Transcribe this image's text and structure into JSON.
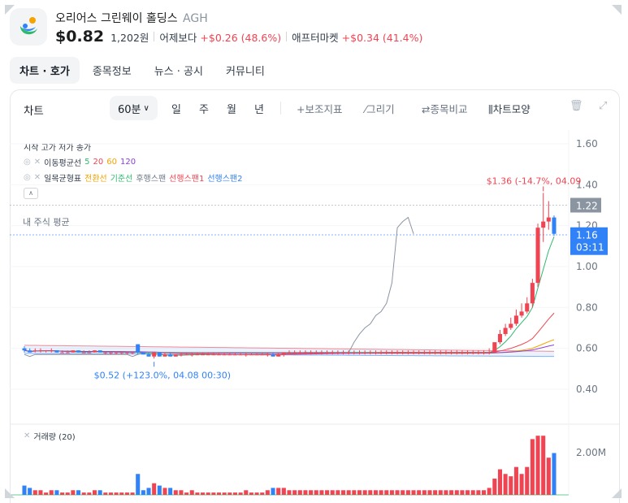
{
  "stock": {
    "name": "오리어스 그린웨이 홀딩스",
    "ticker": "AGH",
    "price": "$0.82",
    "price_krw": "1,202원",
    "prev_label": "어제보다",
    "prev_change": "+$0.26 (48.6%)",
    "after_label": "애프터마켓",
    "after_change": "+$0.34 (41.4%)"
  },
  "tabs": [
    "차트 · 호가",
    "종목정보",
    "뉴스 · 공시",
    "커뮤니티"
  ],
  "toolbar": {
    "title": "차트",
    "period": "60분",
    "periods": [
      "일",
      "주",
      "월",
      "년"
    ],
    "tools": [
      "+보조지표",
      "⁄그리기",
      "⇄종목비교",
      "⫼차트모양"
    ]
  },
  "legend": {
    "ohlc": "시작 고가 저가 종가",
    "ma_label": "이동평균선",
    "ma": [
      {
        "label": "5",
        "color": "#2dba6e"
      },
      {
        "label": "20",
        "color": "#f04452"
      },
      {
        "label": "60",
        "color": "#f4a300"
      },
      {
        "label": "120",
        "color": "#8b3fd9"
      }
    ],
    "ichimoku_label": "일목균형표",
    "ichimoku": [
      {
        "label": "전환선",
        "color": "#f4a300"
      },
      {
        "label": "기준선",
        "color": "#2dba6e"
      },
      {
        "label": "후행스팬",
        "color": "#6b7684"
      },
      {
        "label": "선행스팬1",
        "color": "#f04452"
      },
      {
        "label": "선행스팬2",
        "color": "#3182f6"
      }
    ],
    "volume_label": "거래량 (20)"
  },
  "annotations": {
    "avg_label": "내 주식 평균",
    "high": "$1.36 (-14.7%, 04.09",
    "low": "$0.52 (+123.0%, 04.08 00:30)",
    "last_price": "1.22",
    "current_price": "1.16",
    "countdown": "03:11"
  },
  "chart_data": {
    "type": "candlestick",
    "y_ticks": [
      "1.60",
      "1.40",
      "1.20",
      "1.00",
      "0.80",
      "0.60",
      "0.40"
    ],
    "ylim": [
      0.4,
      1.6
    ],
    "volume_tick": "2.00M",
    "candles": [
      {
        "o": 0.6,
        "h": 0.61,
        "l": 0.58,
        "c": 0.59
      },
      {
        "o": 0.59,
        "h": 0.6,
        "l": 0.58,
        "c": 0.58
      },
      {
        "o": 0.59,
        "h": 0.6,
        "l": 0.58,
        "c": 0.59
      },
      {
        "o": 0.59,
        "h": 0.6,
        "l": 0.58,
        "c": 0.59
      },
      {
        "o": 0.59,
        "h": 0.59,
        "l": 0.58,
        "c": 0.59
      },
      {
        "o": 0.59,
        "h": 0.6,
        "l": 0.58,
        "c": 0.59
      },
      {
        "o": 0.59,
        "h": 0.59,
        "l": 0.58,
        "c": 0.58
      },
      {
        "o": 0.58,
        "h": 0.59,
        "l": 0.58,
        "c": 0.58
      },
      {
        "o": 0.58,
        "h": 0.59,
        "l": 0.58,
        "c": 0.58
      },
      {
        "o": 0.58,
        "h": 0.59,
        "l": 0.58,
        "c": 0.59
      },
      {
        "o": 0.59,
        "h": 0.59,
        "l": 0.58,
        "c": 0.58
      },
      {
        "o": 0.58,
        "h": 0.59,
        "l": 0.58,
        "c": 0.58
      },
      {
        "o": 0.58,
        "h": 0.59,
        "l": 0.58,
        "c": 0.58
      },
      {
        "o": 0.58,
        "h": 0.59,
        "l": 0.58,
        "c": 0.59
      },
      {
        "o": 0.59,
        "h": 0.59,
        "l": 0.58,
        "c": 0.58
      },
      {
        "o": 0.58,
        "h": 0.58,
        "l": 0.57,
        "c": 0.58
      },
      {
        "o": 0.58,
        "h": 0.58,
        "l": 0.57,
        "c": 0.58
      },
      {
        "o": 0.58,
        "h": 0.58,
        "l": 0.57,
        "c": 0.58
      },
      {
        "o": 0.58,
        "h": 0.58,
        "l": 0.57,
        "c": 0.58
      },
      {
        "o": 0.58,
        "h": 0.58,
        "l": 0.57,
        "c": 0.58
      },
      {
        "o": 0.58,
        "h": 0.58,
        "l": 0.57,
        "c": 0.58
      },
      {
        "o": 0.62,
        "h": 0.62,
        "l": 0.57,
        "c": 0.58
      },
      {
        "o": 0.58,
        "h": 0.58,
        "l": 0.57,
        "c": 0.57
      },
      {
        "o": 0.57,
        "h": 0.58,
        "l": 0.56,
        "c": 0.56
      },
      {
        "o": 0.56,
        "h": 0.58,
        "l": 0.55,
        "c": 0.58
      },
      {
        "o": 0.58,
        "h": 0.58,
        "l": 0.56,
        "c": 0.56
      },
      {
        "o": 0.56,
        "h": 0.58,
        "l": 0.56,
        "c": 0.57
      },
      {
        "o": 0.57,
        "h": 0.58,
        "l": 0.56,
        "c": 0.56
      },
      {
        "o": 0.56,
        "h": 0.57,
        "l": 0.56,
        "c": 0.57
      },
      {
        "o": 0.57,
        "h": 0.58,
        "l": 0.56,
        "c": 0.57
      },
      {
        "o": 0.57,
        "h": 0.58,
        "l": 0.57,
        "c": 0.57
      },
      {
        "o": 0.57,
        "h": 0.58,
        "l": 0.56,
        "c": 0.57
      },
      {
        "o": 0.57,
        "h": 0.58,
        "l": 0.57,
        "c": 0.57
      },
      {
        "o": 0.57,
        "h": 0.58,
        "l": 0.57,
        "c": 0.57
      },
      {
        "o": 0.57,
        "h": 0.58,
        "l": 0.57,
        "c": 0.57
      },
      {
        "o": 0.57,
        "h": 0.58,
        "l": 0.57,
        "c": 0.57
      },
      {
        "o": 0.57,
        "h": 0.58,
        "l": 0.57,
        "c": 0.57
      },
      {
        "o": 0.57,
        "h": 0.58,
        "l": 0.57,
        "c": 0.57
      },
      {
        "o": 0.57,
        "h": 0.58,
        "l": 0.57,
        "c": 0.57
      },
      {
        "o": 0.57,
        "h": 0.58,
        "l": 0.57,
        "c": 0.57
      },
      {
        "o": 0.57,
        "h": 0.58,
        "l": 0.57,
        "c": 0.57
      },
      {
        "o": 0.57,
        "h": 0.58,
        "l": 0.56,
        "c": 0.57
      },
      {
        "o": 0.57,
        "h": 0.58,
        "l": 0.57,
        "c": 0.57
      },
      {
        "o": 0.57,
        "h": 0.58,
        "l": 0.57,
        "c": 0.57
      },
      {
        "o": 0.57,
        "h": 0.58,
        "l": 0.57,
        "c": 0.57
      },
      {
        "o": 0.57,
        "h": 0.58,
        "l": 0.56,
        "c": 0.57
      },
      {
        "o": 0.57,
        "h": 0.58,
        "l": 0.56,
        "c": 0.56
      },
      {
        "o": 0.56,
        "h": 0.58,
        "l": 0.56,
        "c": 0.57
      },
      {
        "o": 0.57,
        "h": 0.58,
        "l": 0.56,
        "c": 0.58
      },
      {
        "o": 0.58,
        "h": 0.59,
        "l": 0.57,
        "c": 0.58
      },
      {
        "o": 0.58,
        "h": 0.59,
        "l": 0.57,
        "c": 0.58
      },
      {
        "o": 0.58,
        "h": 0.59,
        "l": 0.57,
        "c": 0.58
      },
      {
        "o": 0.58,
        "h": 0.59,
        "l": 0.57,
        "c": 0.58
      },
      {
        "o": 0.58,
        "h": 0.59,
        "l": 0.57,
        "c": 0.58
      },
      {
        "o": 0.58,
        "h": 0.59,
        "l": 0.57,
        "c": 0.58
      },
      {
        "o": 0.58,
        "h": 0.59,
        "l": 0.57,
        "c": 0.58
      },
      {
        "o": 0.58,
        "h": 0.59,
        "l": 0.57,
        "c": 0.58
      },
      {
        "o": 0.58,
        "h": 0.59,
        "l": 0.57,
        "c": 0.58
      },
      {
        "o": 0.58,
        "h": 0.59,
        "l": 0.57,
        "c": 0.58
      },
      {
        "o": 0.58,
        "h": 0.59,
        "l": 0.57,
        "c": 0.58
      },
      {
        "o": 0.58,
        "h": 0.59,
        "l": 0.57,
        "c": 0.58
      },
      {
        "o": 0.58,
        "h": 0.59,
        "l": 0.57,
        "c": 0.58
      },
      {
        "o": 0.58,
        "h": 0.59,
        "l": 0.57,
        "c": 0.58
      },
      {
        "o": 0.58,
        "h": 0.59,
        "l": 0.57,
        "c": 0.58
      },
      {
        "o": 0.58,
        "h": 0.59,
        "l": 0.57,
        "c": 0.58
      },
      {
        "o": 0.58,
        "h": 0.59,
        "l": 0.57,
        "c": 0.58
      },
      {
        "o": 0.58,
        "h": 0.59,
        "l": 0.57,
        "c": 0.58
      },
      {
        "o": 0.58,
        "h": 0.59,
        "l": 0.57,
        "c": 0.58
      },
      {
        "o": 0.58,
        "h": 0.59,
        "l": 0.57,
        "c": 0.58
      },
      {
        "o": 0.58,
        "h": 0.59,
        "l": 0.57,
        "c": 0.58
      },
      {
        "o": 0.58,
        "h": 0.59,
        "l": 0.57,
        "c": 0.58
      },
      {
        "o": 0.58,
        "h": 0.59,
        "l": 0.57,
        "c": 0.58
      },
      {
        "o": 0.58,
        "h": 0.59,
        "l": 0.57,
        "c": 0.58
      },
      {
        "o": 0.58,
        "h": 0.59,
        "l": 0.57,
        "c": 0.58
      },
      {
        "o": 0.58,
        "h": 0.59,
        "l": 0.57,
        "c": 0.58
      },
      {
        "o": 0.58,
        "h": 0.59,
        "l": 0.57,
        "c": 0.58
      },
      {
        "o": 0.58,
        "h": 0.59,
        "l": 0.57,
        "c": 0.58
      },
      {
        "o": 0.58,
        "h": 0.59,
        "l": 0.57,
        "c": 0.58
      },
      {
        "o": 0.58,
        "h": 0.59,
        "l": 0.57,
        "c": 0.58
      },
      {
        "o": 0.58,
        "h": 0.59,
        "l": 0.57,
        "c": 0.58
      },
      {
        "o": 0.58,
        "h": 0.59,
        "l": 0.57,
        "c": 0.58
      },
      {
        "o": 0.58,
        "h": 0.59,
        "l": 0.57,
        "c": 0.58
      },
      {
        "o": 0.58,
        "h": 0.59,
        "l": 0.57,
        "c": 0.58
      },
      {
        "o": 0.58,
        "h": 0.59,
        "l": 0.57,
        "c": 0.58
      },
      {
        "o": 0.58,
        "h": 0.59,
        "l": 0.57,
        "c": 0.58
      },
      {
        "o": 0.58,
        "h": 0.59,
        "l": 0.57,
        "c": 0.58
      },
      {
        "o": 0.58,
        "h": 0.6,
        "l": 0.57,
        "c": 0.58
      },
      {
        "o": 0.58,
        "h": 0.6,
        "l": 0.58,
        "c": 0.63
      },
      {
        "o": 0.63,
        "h": 0.69,
        "l": 0.62,
        "c": 0.67
      },
      {
        "o": 0.67,
        "h": 0.72,
        "l": 0.66,
        "c": 0.7
      },
      {
        "o": 0.7,
        "h": 0.75,
        "l": 0.69,
        "c": 0.72
      },
      {
        "o": 0.72,
        "h": 0.79,
        "l": 0.71,
        "c": 0.76
      },
      {
        "o": 0.76,
        "h": 0.82,
        "l": 0.75,
        "c": 0.78
      },
      {
        "o": 0.78,
        "h": 0.85,
        "l": 0.77,
        "c": 0.82
      },
      {
        "o": 0.82,
        "h": 0.94,
        "l": 0.8,
        "c": 0.92
      },
      {
        "o": 0.92,
        "h": 1.21,
        "l": 0.9,
        "c": 1.19
      },
      {
        "o": 1.19,
        "h": 1.36,
        "l": 1.12,
        "c": 1.22
      },
      {
        "o": 1.22,
        "h": 1.32,
        "l": 1.18,
        "c": 1.24
      },
      {
        "o": 1.24,
        "h": 1.25,
        "l": 1.15,
        "c": 1.16
      }
    ]
  }
}
